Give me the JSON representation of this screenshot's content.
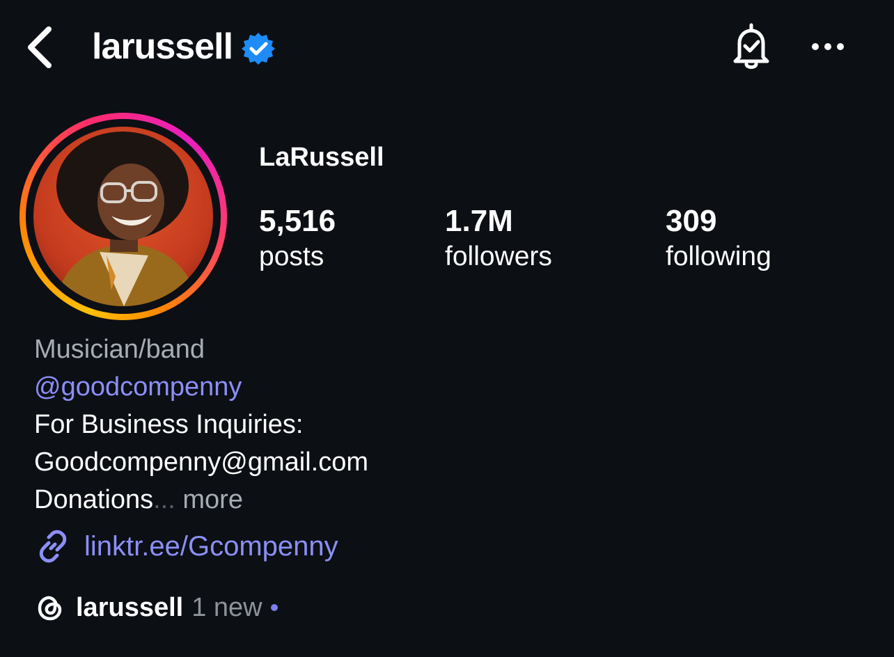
{
  "header": {
    "username": "larussell",
    "verified": true,
    "icons": {
      "back": "chevron-left-icon",
      "notifications": "bell-check-icon",
      "more": "more-horizontal-icon"
    }
  },
  "profile": {
    "display_name": "LaRussell",
    "avatar": "profile-photo-with-story-ring",
    "stats": [
      {
        "value": "5,516",
        "label": "posts"
      },
      {
        "value": "1.7M",
        "label": "followers"
      },
      {
        "value": "309",
        "label": "following"
      }
    ]
  },
  "bio": {
    "category": "Musician/band",
    "mention": "@goodcompenny",
    "line1": "For Business Inquiries:",
    "line2": "Goodcompenny@gmail.com",
    "line3": "Donations",
    "ellipsis": "...",
    "more": "more"
  },
  "link": {
    "icon": "link-icon",
    "text": "linktr.ee/Gcompenny"
  },
  "threads": {
    "icon": "threads-icon",
    "username": "larussell",
    "new_text": "1 new"
  },
  "colors": {
    "background": "#0c0f14",
    "link": "#8c8ff7",
    "secondary_text": "#a8acb3",
    "verified_badge": "#1d8cf8"
  }
}
